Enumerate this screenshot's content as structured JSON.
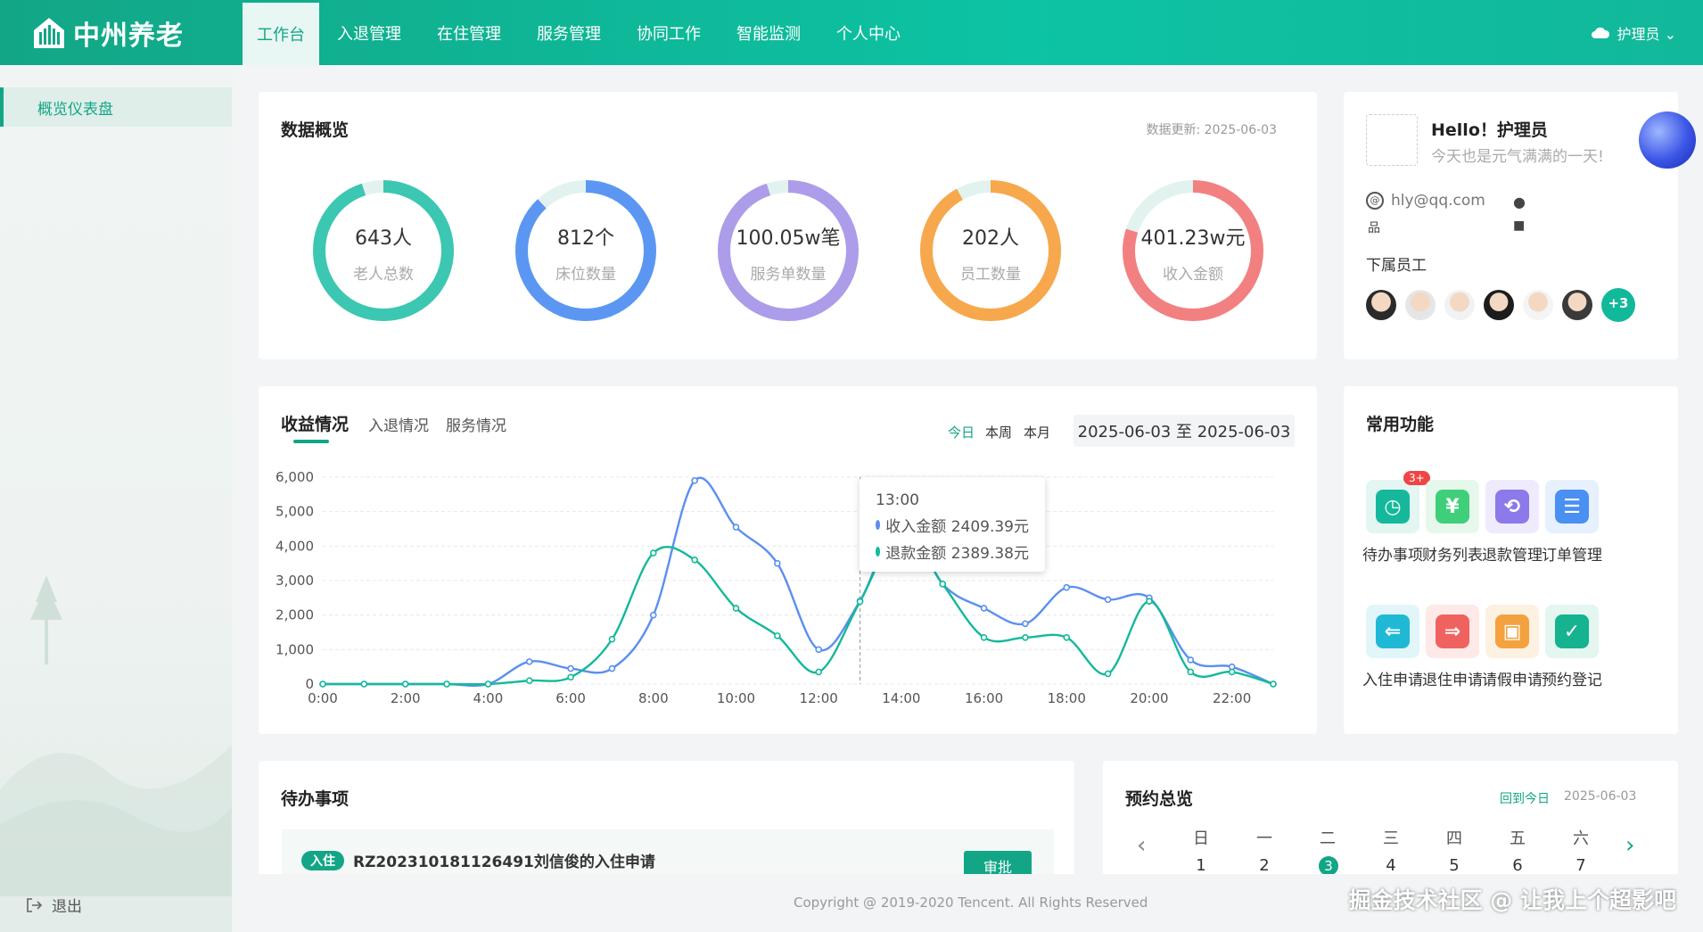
{
  "header": {
    "logo_text": "中州养老",
    "nav": [
      "工作台",
      "入退管理",
      "在住管理",
      "服务管理",
      "协同工作",
      "智能监测",
      "个人中心"
    ],
    "user": "护理员 ⌄"
  },
  "sidebar": {
    "items": [
      {
        "label": "概览仪表盘"
      }
    ],
    "logout": "退出"
  },
  "overview": {
    "title": "数据概览",
    "updated_label": "数据更新:",
    "updated_date": "2025-06-03",
    "stats": [
      {
        "value": "643人",
        "label": "老人总数",
        "color": "#3cc7b2",
        "fraction": 0.95
      },
      {
        "value": "812个",
        "label": "床位数量",
        "color": "#5b97f2",
        "fraction": 0.88
      },
      {
        "value": "100.05w笔",
        "label": "服务单数量",
        "color": "#ad9ce9",
        "fraction": 0.95
      },
      {
        "value": "202人",
        "label": "员工数量",
        "color": "#f7a84c",
        "fraction": 0.92
      },
      {
        "value": "401.23w元",
        "label": "收入金额",
        "color": "#f38080",
        "fraction": 0.8
      }
    ]
  },
  "profile": {
    "greeting": "Hello！护理员",
    "subtitle": "今天也是元气满满的一天!",
    "email": "hly@qq.com",
    "staff_title": "下属员工",
    "more_count": "+3"
  },
  "revenue": {
    "tabs": [
      "收益情况",
      "入退情况",
      "服务情况"
    ],
    "ranges": [
      "今日",
      "本周",
      "本月"
    ],
    "date_range": "2025-06-03 至 2025-06-03",
    "tooltip": {
      "time": "13:00",
      "rows": [
        {
          "label": "收入金额 2409.39元",
          "color": "#5b8ff0"
        },
        {
          "label": "退款金额 2389.38元",
          "color": "#14b99a"
        }
      ]
    }
  },
  "chart_data": {
    "type": "line",
    "x": [
      "0:00",
      "1:00",
      "2:00",
      "3:00",
      "4:00",
      "5:00",
      "6:00",
      "7:00",
      "8:00",
      "9:00",
      "10:00",
      "11:00",
      "12:00",
      "13:00",
      "14:00",
      "15:00",
      "16:00",
      "17:00",
      "18:00",
      "19:00",
      "20:00",
      "21:00",
      "22:00",
      "23:00"
    ],
    "x_tick_labels": [
      "0:00",
      "2:00",
      "4:00",
      "6:00",
      "8:00",
      "10:00",
      "12:00",
      "14:00",
      "16:00",
      "18:00",
      "20:00",
      "22:00"
    ],
    "ylim": [
      0,
      6000
    ],
    "y_ticks": [
      "0",
      "1,000",
      "2,000",
      "3,000",
      "4,000",
      "5,000",
      "6,000"
    ],
    "grid": true,
    "series": [
      {
        "name": "收入金额",
        "color": "#5b8ff0",
        "values": [
          0,
          0,
          0,
          0,
          0,
          650,
          450,
          450,
          2000,
          5900,
          4550,
          3500,
          1000,
          2409.39,
          4800,
          2900,
          2200,
          1750,
          2800,
          2450,
          2500,
          700,
          500,
          0
        ]
      },
      {
        "name": "退款金额",
        "color": "#14b99a",
        "values": [
          0,
          0,
          0,
          0,
          0,
          100,
          200,
          1300,
          3800,
          3600,
          2200,
          1400,
          350,
          2389.38,
          4500,
          2900,
          1350,
          1350,
          1350,
          300,
          2400,
          350,
          350,
          0
        ]
      }
    ]
  },
  "functions": {
    "title": "常用功能",
    "badge": "3+",
    "items": [
      {
        "label": "待办事项",
        "icon": "alarm-clock-icon",
        "color": "#16b89c",
        "bg": "#e3f6f1"
      },
      {
        "label": "财务列表",
        "icon": "yen-document-icon",
        "color": "#3fcf7a",
        "bg": "#e6f8ec"
      },
      {
        "label": "退款管理",
        "icon": "refund-icon",
        "color": "#8c79ea",
        "bg": "#efebfd"
      },
      {
        "label": "订单管理",
        "icon": "order-list-icon",
        "color": "#4a8ff2",
        "bg": "#e7f0fd"
      },
      {
        "label": "入住申请",
        "icon": "check-in-icon",
        "color": "#1fb9d6",
        "bg": "#e2f6fa"
      },
      {
        "label": "退住申请",
        "icon": "check-out-icon",
        "color": "#f0625f",
        "bg": "#fde9e8"
      },
      {
        "label": "请假申请",
        "icon": "leave-icon",
        "color": "#f4a23f",
        "bg": "#fdf1e2"
      },
      {
        "label": "预约登记",
        "icon": "calendar-check-icon",
        "color": "#15b38f",
        "bg": "#e3f6ef"
      }
    ]
  },
  "todo": {
    "title": "待办事项",
    "items": [
      {
        "tag": "入住",
        "text": "RZ202310181126491刘信俊的入住申请",
        "action": "审批"
      }
    ]
  },
  "appointments": {
    "title": "预约总览",
    "back_today": "回到今日",
    "date": "2025-06-03",
    "weekdays": [
      "日",
      "一",
      "二",
      "三",
      "四",
      "五",
      "六"
    ],
    "days": [
      "1",
      "2",
      "3",
      "4",
      "5",
      "6",
      "7"
    ],
    "selected_day": "3",
    "prev": "‹",
    "next": "›"
  },
  "footer": {
    "copyright": "Copyright @ 2019-2020 Tencent. All Rights Reserved"
  },
  "watermark": "掘金技术社区 @ 让我上个超影吧"
}
